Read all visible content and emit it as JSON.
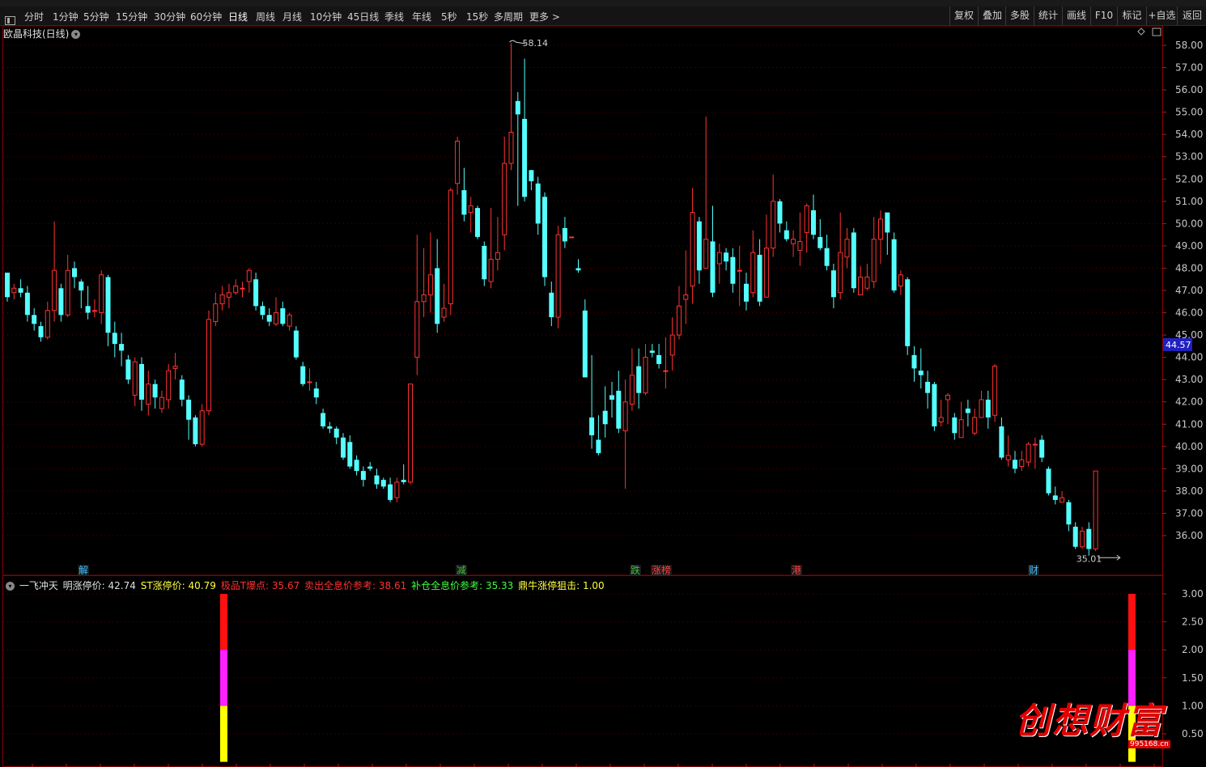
{
  "toolbar": {
    "items": [
      "分时",
      "1分钟",
      "5分钟",
      "15分钟",
      "30分钟",
      "60分钟",
      "日线",
      "周线",
      "月线",
      "10分钟",
      "45日线",
      "季线",
      "年线",
      "5秒",
      "15秒",
      "多周期",
      "更多 >"
    ],
    "active": "日线",
    "right": [
      "复权",
      "叠加",
      "多股",
      "统计",
      "画线",
      "F10",
      "标记",
      "+自选",
      "返回"
    ]
  },
  "chart": {
    "title": "欧晶科技(日线)",
    "high_label": "58.14",
    "low_label": "35.01",
    "current_price": "44.57",
    "yaxis": [
      "58.00",
      "57.00",
      "56.00",
      "55.00",
      "54.00",
      "53.00",
      "52.00",
      "51.00",
      "50.00",
      "49.00",
      "48.00",
      "47.00",
      "46.00",
      "45.00",
      "44.00",
      "43.00",
      "42.00",
      "41.00",
      "40.00",
      "39.00",
      "38.00",
      "37.00",
      "36.00"
    ],
    "markers": [
      {
        "text": "解",
        "color": "#3fbfff"
      },
      {
        "text": "减",
        "color": "#3fbf3f"
      },
      {
        "text": "跌",
        "color": "#3fbf3f"
      },
      {
        "text": "涨榜",
        "color": "#ff4040"
      },
      {
        "text": "港",
        "color": "#ff4040"
      },
      {
        "text": "财",
        "color": "#3fbfff"
      }
    ]
  },
  "indicator": {
    "name": "一飞冲天",
    "fields": [
      {
        "label": "明涨停价:",
        "value": "42.74",
        "color": "#e0e0e0"
      },
      {
        "label": "ST涨停价:",
        "value": "40.79",
        "color": "#ffff40"
      },
      {
        "label": "极品T爆点:",
        "value": "35.67",
        "color": "#ff3030"
      },
      {
        "label": "卖出全息价参考:",
        "value": "38.61",
        "color": "#ff3030"
      },
      {
        "label": "补仓全息价参考:",
        "value": "35.33",
        "color": "#40ff40"
      },
      {
        "label": "鼎牛涨停狙击:",
        "value": "1.00",
        "color": "#ffff40"
      }
    ],
    "yaxis": [
      "3.00",
      "2.50",
      "2.00",
      "1.50",
      "1.00",
      "0.50"
    ]
  },
  "watermark": {
    "text": "创想财富",
    "url": "995168.cn"
  },
  "colors": {
    "up": "#ff3232",
    "down": "#54ffff",
    "grid": "#5a0000",
    "frame": "#8b0000"
  }
}
